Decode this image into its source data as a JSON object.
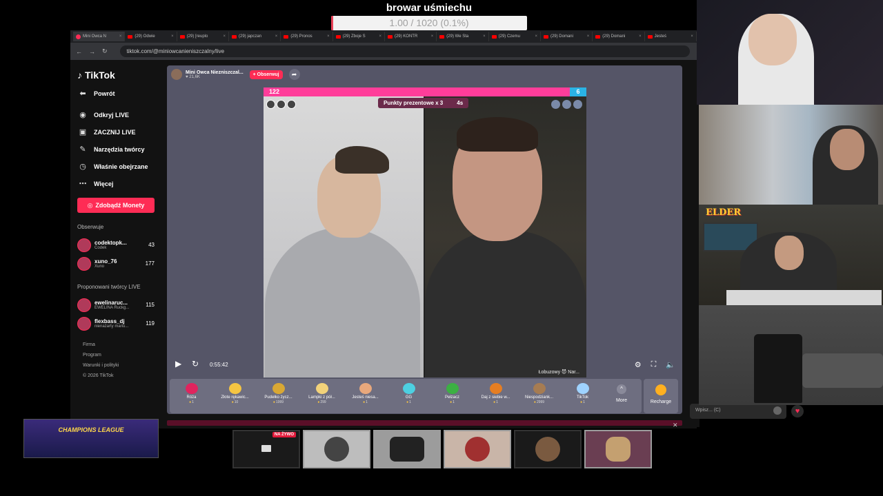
{
  "overlay": {
    "title": "browar uśmiechu",
    "progress_text": "1.00 / 1020 (0.1%)",
    "progress_fraction": 0.001,
    "accent": "#e94057"
  },
  "browser": {
    "tabs": [
      {
        "label": "Mini Owca N",
        "kind": "tt"
      },
      {
        "label": "(29) Odwie",
        "kind": "yt"
      },
      {
        "label": "(29) [reuplo",
        "kind": "yt"
      },
      {
        "label": "(29) japczan",
        "kind": "yt"
      },
      {
        "label": "(29) Pronos",
        "kind": "yt"
      },
      {
        "label": "(29) Zboje S",
        "kind": "yt"
      },
      {
        "label": "(29) KONTR",
        "kind": "yt"
      },
      {
        "label": "(29) We Sta",
        "kind": "yt"
      },
      {
        "label": "(29) Czemu",
        "kind": "yt"
      },
      {
        "label": "(29) Domani",
        "kind": "yt"
      },
      {
        "label": "(29) Domani",
        "kind": "yt"
      },
      {
        "label": "Jesteś",
        "kind": "yt"
      }
    ],
    "url": "tiktok.com/@miniowcanieniszczalny/live"
  },
  "sidebar": {
    "logo": "TikTok",
    "back": "Powrót",
    "nav": [
      {
        "label": "Odkryj LIVE",
        "icon": "live-icon"
      },
      {
        "label": "ZACZNIJ LIVE",
        "icon": "camera-icon"
      },
      {
        "label": "Narzędzia twórcy",
        "icon": "lightbulb-icon"
      },
      {
        "label": "Właśnie obejrzane",
        "icon": "history-icon"
      },
      {
        "label": "Więcej",
        "icon": "more-icon"
      }
    ],
    "coins_button": "Zdobądź Monety",
    "following_title": "Obserwuje",
    "following": [
      {
        "name": "codektopk...",
        "sub": "Codek",
        "count": "43"
      },
      {
        "name": "xuno_76",
        "sub": "Xuno",
        "count": "177"
      }
    ],
    "suggested_title": "Proponowani twórcy LIVE",
    "suggested": [
      {
        "name": "ewelinaruc...",
        "sub": "EWELINA Ruckg...",
        "count": "115"
      },
      {
        "name": "flexbass_dj",
        "sub": "nienażarty mariu...",
        "count": "119"
      }
    ],
    "footer": [
      "Firma",
      "Program",
      "Warunki i polityki",
      "© 2026 TikTok"
    ]
  },
  "live": {
    "host_name": "Mini Owca Niezniszczal...",
    "viewers": "21,6K",
    "follow_label": "+ Obserwuj",
    "score_left": "122",
    "score_right": "6",
    "gift_points": "Punkty prezentowe x 3",
    "timer": "4s",
    "right_user": "Łobuzowy 😈 Nar...",
    "elapsed": "0:55:42",
    "gifts": [
      {
        "name": "Róża",
        "price": "1",
        "color": "#e0245e"
      },
      {
        "name": "Złote rękawic...",
        "price": "10",
        "color": "#f5c542"
      },
      {
        "name": "Pudełko życz...",
        "price": "1999",
        "color": "#d9a834"
      },
      {
        "name": "Lampki z pół...",
        "price": "299",
        "color": "#f2d27a"
      },
      {
        "name": "Jesteś niesa...",
        "price": "1",
        "color": "#e8a87c"
      },
      {
        "name": "GG",
        "price": "1",
        "color": "#4dd0e1"
      },
      {
        "name": "Pełzacz",
        "price": "1",
        "color": "#3cb043"
      },
      {
        "name": "Daj z siebie w...",
        "price": "1",
        "color": "#e67e22"
      },
      {
        "name": "Niespodziank...",
        "price": "2999",
        "color": "#a67c52"
      },
      {
        "name": "TikTok",
        "price": "1",
        "color": "#9fd3ff"
      }
    ],
    "more_label": "More",
    "recharge_label": "Recharge"
  },
  "chat": {
    "placeholder": "Wpisz... (C)"
  },
  "cams": {
    "elder_logo": "ELDER"
  },
  "bottom": {
    "league_label": "CHAMPIONS LEAGUE",
    "live_badge": "NA ŻYWO"
  }
}
